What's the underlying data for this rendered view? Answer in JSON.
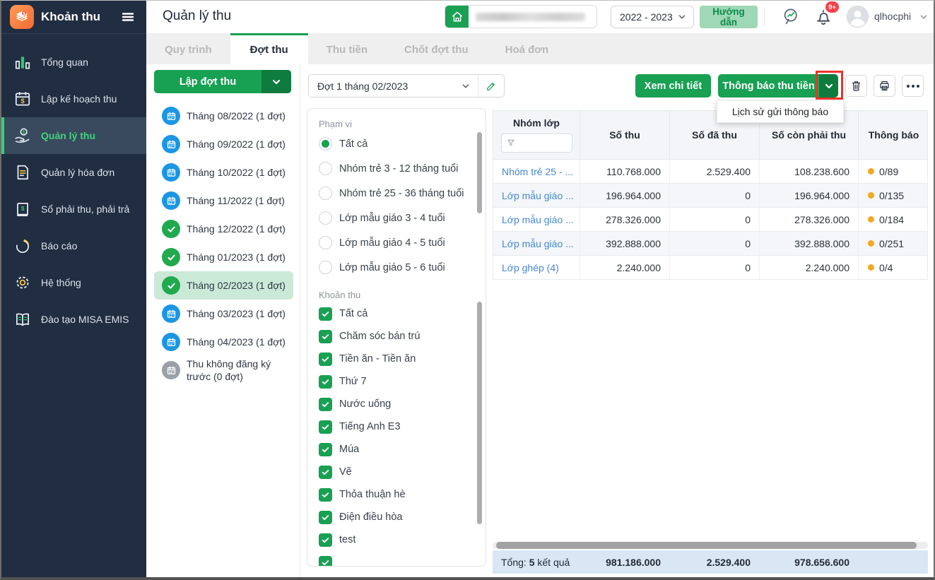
{
  "app": {
    "title": "Khoản thu"
  },
  "sidebar": {
    "items": [
      {
        "label": "Tổng quan",
        "icon": "bar-chart-icon",
        "name": "tong-quan",
        "active": false
      },
      {
        "label": "Lập kế hoạch thu",
        "icon": "calendar-plan-icon",
        "name": "lap-ke-hoach-thu",
        "active": false
      },
      {
        "label": "Quản lý thu",
        "icon": "hand-money-icon",
        "name": "quan-ly-thu",
        "active": true
      },
      {
        "label": "Quản lý hóa đơn",
        "icon": "invoice-icon",
        "name": "quan-ly-hoa-don",
        "active": false
      },
      {
        "label": "Sổ phải thu, phải trả",
        "icon": "ledger-icon",
        "name": "so-phai-thu-phai-tra",
        "active": false
      },
      {
        "label": "Báo cáo",
        "icon": "pie-chart-icon",
        "name": "bao-cao",
        "active": false
      },
      {
        "label": "Hệ thống",
        "icon": "gear-icon",
        "name": "he-thong",
        "active": false
      },
      {
        "label": "Đào tạo MISA EMIS",
        "icon": "book-icon",
        "name": "dao-tao-misa-emis",
        "active": false
      }
    ]
  },
  "header": {
    "title": "Quản lý thu",
    "school_year": "2022 - 2023",
    "guide_button": "Hướng dẫn",
    "notification_badge": "9+",
    "username": "qlhocphi"
  },
  "tabs": [
    {
      "label": "Quy trình",
      "name": "quy-trinh",
      "active": false
    },
    {
      "label": "Đợt thu",
      "name": "dot-thu",
      "active": true
    },
    {
      "label": "Thu tiền",
      "name": "thu-tien",
      "active": false
    },
    {
      "label": "Chốt đợt thu",
      "name": "chot-dot-thu",
      "active": false
    },
    {
      "label": "Hoá đơn",
      "name": "hoa-don",
      "active": false
    }
  ],
  "month_panel": {
    "create_button": "Lập đợt thu",
    "months": [
      {
        "label": "Tháng 08/2022 (1 đợt)",
        "status": "planned",
        "selected": false
      },
      {
        "label": "Tháng 09/2022 (1 đợt)",
        "status": "planned",
        "selected": false
      },
      {
        "label": "Tháng 10/2022 (1 đợt)",
        "status": "planned",
        "selected": false
      },
      {
        "label": "Tháng 11/2022 (1 đợt)",
        "status": "planned",
        "selected": false
      },
      {
        "label": "Tháng 12/2022 (1 đợt)",
        "status": "done",
        "selected": false
      },
      {
        "label": "Tháng 01/2023 (1 đợt)",
        "status": "done",
        "selected": false
      },
      {
        "label": "Tháng 02/2023 (1 đợt)",
        "status": "done",
        "selected": true
      },
      {
        "label": "Tháng 03/2023 (1 đợt)",
        "status": "planned",
        "selected": false
      },
      {
        "label": "Tháng 04/2023 (1 đợt)",
        "status": "planned",
        "selected": false
      },
      {
        "label": "Thu không đăng ký trước (0 đợt)",
        "status": "none",
        "selected": false
      }
    ]
  },
  "batch": {
    "selected_batch": "Đợt 1 tháng 02/2023"
  },
  "filters": {
    "scope_label": "Phạm vi",
    "scopes": [
      {
        "label": "Tất cả",
        "checked": true
      },
      {
        "label": "Nhóm trẻ 3 - 12 tháng tuổi",
        "checked": false
      },
      {
        "label": "Nhóm trẻ 25 - 36 tháng tuổi",
        "checked": false
      },
      {
        "label": "Lớp mẫu giáo 3 - 4 tuổi",
        "checked": false
      },
      {
        "label": "Lớp mẫu giáo 4 - 5 tuổi",
        "checked": false
      },
      {
        "label": "Lớp mẫu giáo 5 - 6 tuổi",
        "checked": false
      }
    ],
    "fees_label": "Khoản thu",
    "fees": [
      {
        "label": "Tất cả",
        "checked": true
      },
      {
        "label": "Chăm sóc bán trú",
        "checked": true
      },
      {
        "label": "Tiền ăn - Tiền ăn",
        "checked": true
      },
      {
        "label": "Thứ 7",
        "checked": true
      },
      {
        "label": "Nước uống",
        "checked": true
      },
      {
        "label": "Tiếng Anh E3",
        "checked": true
      },
      {
        "label": "Múa",
        "checked": true
      },
      {
        "label": "Vẽ",
        "checked": true
      },
      {
        "label": "Thỏa thuận hè",
        "checked": true
      },
      {
        "label": "Điện điều hòa",
        "checked": true
      },
      {
        "label": "test",
        "checked": true
      }
    ]
  },
  "toolbar": {
    "view_detail": "Xem chi tiết",
    "notify": "Thông báo thu tiền",
    "menu_item": "Lịch sử gửi thông báo"
  },
  "table": {
    "columns": [
      "Nhóm lớp",
      "Số thu",
      "Số đã thu",
      "Số còn phải thu",
      "Thông báo"
    ],
    "rows": [
      {
        "group": "Nhóm trẻ 25 - ...",
        "so_thu": "110.768.000",
        "so_da_thu": "2.529.400",
        "so_con_phai_thu": "108.238.600",
        "thong_bao": "0/89"
      },
      {
        "group": "Lớp mẫu giáo ...",
        "so_thu": "196.964.000",
        "so_da_thu": "0",
        "so_con_phai_thu": "196.964.000",
        "thong_bao": "0/135"
      },
      {
        "group": "Lớp mẫu giáo ...",
        "so_thu": "278.326.000",
        "so_da_thu": "0",
        "so_con_phai_thu": "278.326.000",
        "thong_bao": "0/184"
      },
      {
        "group": "Lớp mẫu giáo ...",
        "so_thu": "392.888.000",
        "so_da_thu": "0",
        "so_con_phai_thu": "392.888.000",
        "thong_bao": "0/251"
      },
      {
        "group": "Lớp ghép (4)",
        "so_thu": "2.240.000",
        "so_da_thu": "0",
        "so_con_phai_thu": "2.240.000",
        "thong_bao": "0/4"
      }
    ],
    "summary": {
      "label": "Tổng:",
      "count": "5",
      "suffix": "kết quả",
      "so_thu": "981.186.000",
      "so_da_thu": "2.529.400",
      "so_con_phai_thu": "978.656.600"
    }
  },
  "colors": {
    "primary_green": "#18a053",
    "dark_green": "#0d7c3e",
    "selected_month_bg": "#cbe9d7",
    "blue_icon": "#1b96e4",
    "link_blue": "#4787d2",
    "orange_dot": "#f5a623",
    "annotation_red": "#e8352b",
    "sidebar_bg": "#212d41",
    "footer_bg": "#d9e7f5"
  }
}
